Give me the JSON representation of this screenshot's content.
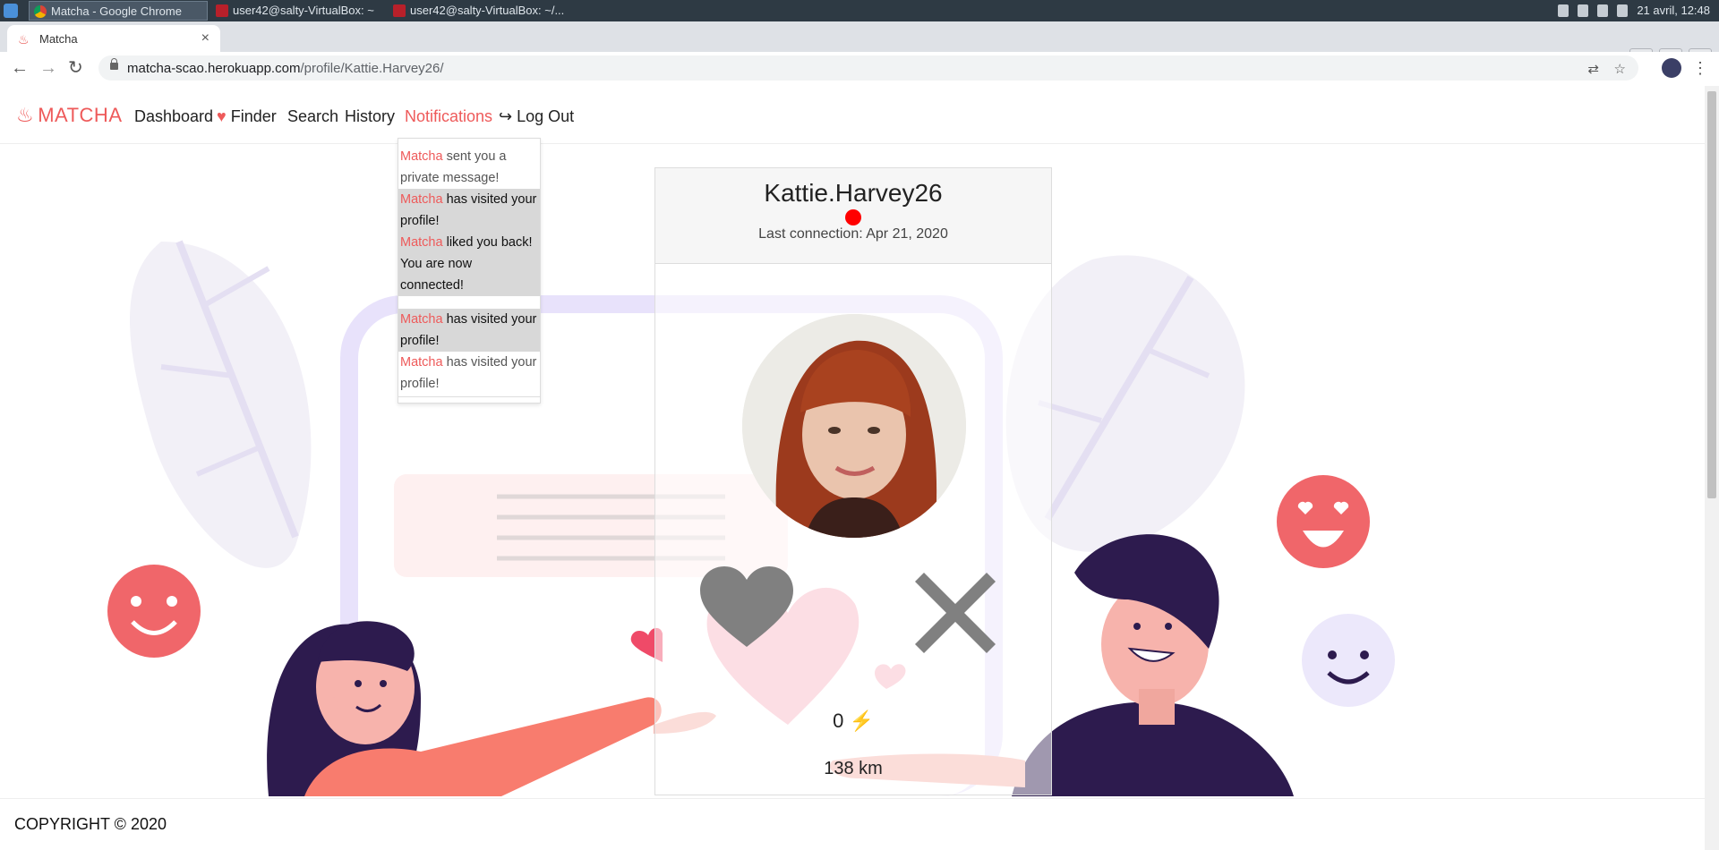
{
  "taskbar": {
    "tasks": [
      {
        "label": "Matcha - Google Chrome",
        "active": true
      },
      {
        "label": "user42@salty-VirtualBox: ~",
        "active": false
      },
      {
        "label": "user42@salty-VirtualBox: ~/...",
        "active": false
      }
    ],
    "clock": "21 avril, 12:48"
  },
  "browser": {
    "tab_title": "Matcha",
    "url_host": "matcha-scao.herokuapp.com",
    "url_path": "/profile/Kattie.Harvey26/"
  },
  "nav": {
    "brand": "MATCHA",
    "items": [
      {
        "label": "Dashboard"
      },
      {
        "label": "Finder"
      },
      {
        "label": "Search"
      },
      {
        "label": "History"
      },
      {
        "label": "Notifications"
      },
      {
        "label": "Log Out"
      }
    ]
  },
  "notifications": [
    {
      "who": "Matcha",
      "text": " sent you a private message!",
      "unread": false
    },
    {
      "who": "Matcha",
      "text": " has visited your profile!",
      "unread": true
    },
    {
      "who": "Matcha",
      "text": " liked you back! You are now connected!",
      "unread": true
    },
    {
      "who": "Matcha",
      "text": " has visited your profile!",
      "unread": true
    },
    {
      "who": "Matcha",
      "text": " has visited your profile!",
      "unread": false
    }
  ],
  "profile": {
    "username": "Kattie.Harvey26",
    "last_connection": "Last connection: Apr 21, 2020",
    "score": "0",
    "distance": "138 km"
  },
  "footer": {
    "text": "COPYRIGHT © 2020"
  },
  "colors": {
    "brand": "#ee5a5a",
    "online": "#ff0000",
    "bolt": "#f5b800"
  }
}
